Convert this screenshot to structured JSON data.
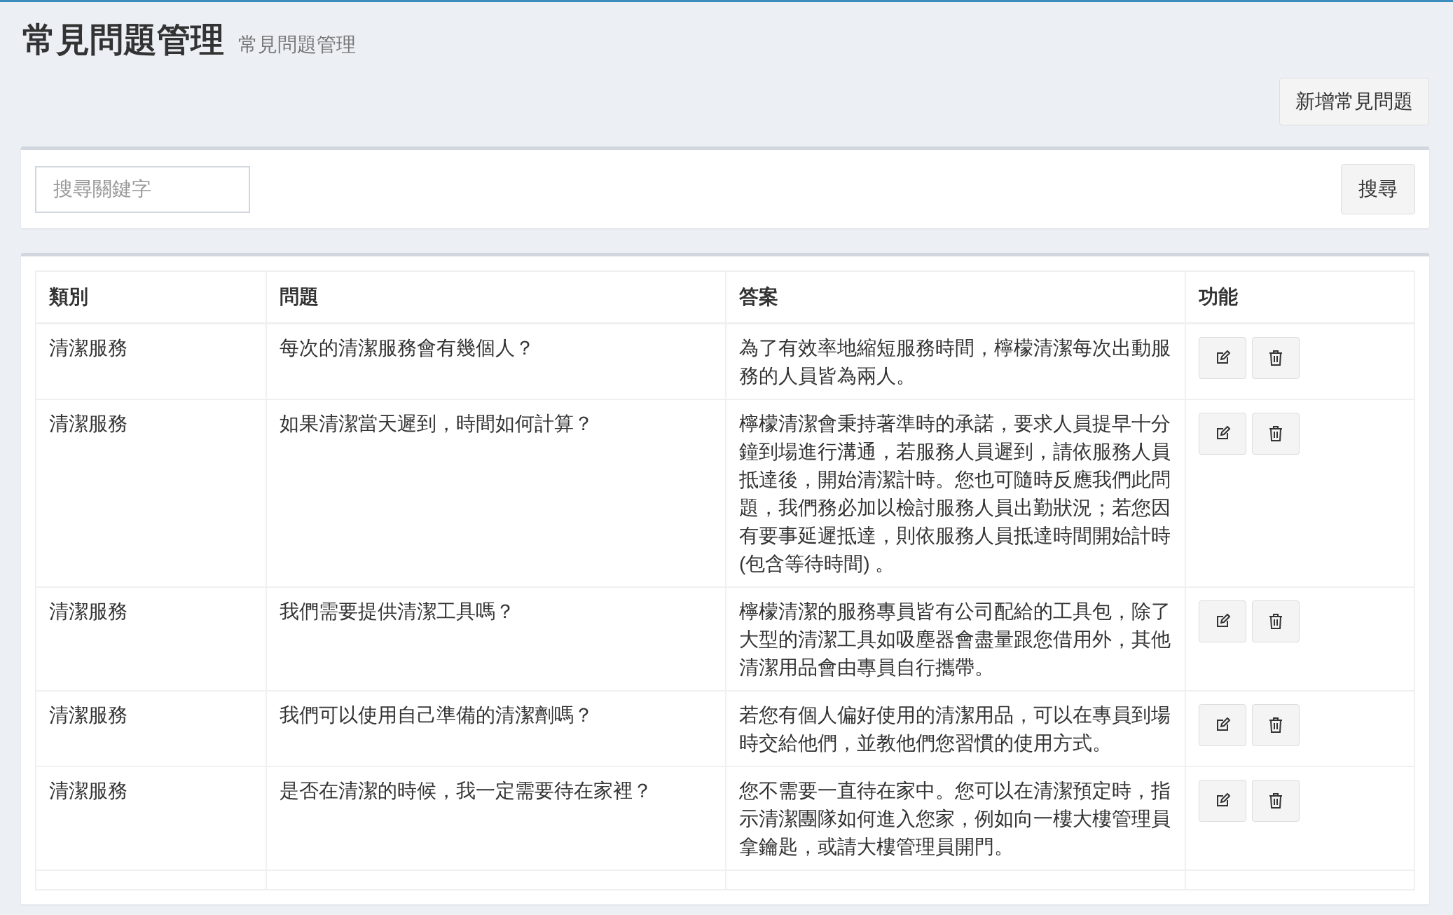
{
  "header": {
    "title": "常見問題管理",
    "subtitle": "常見問題管理"
  },
  "add_button": "新增常見問題",
  "search": {
    "placeholder": "搜尋關鍵字",
    "button": "搜尋"
  },
  "table": {
    "columns": [
      "類別",
      "問題",
      "答案",
      "功能"
    ],
    "rows": [
      {
        "category": "清潔服務",
        "question": "每次的清潔服務會有幾個人？",
        "answer": "為了有效率地縮短服務時間，檸檬清潔每次出動服務的人員皆為兩人。"
      },
      {
        "category": "清潔服務",
        "question": "如果清潔當天遲到，時間如何計算？",
        "answer": "檸檬清潔會秉持著準時的承諾，要求人員提早十分鐘到場進行溝通，若服務人員遲到，請依服務人員抵達後，開始清潔計時。您也可隨時反應我們此問題，我們務必加以檢討服務人員出勤狀況；若您因有要事延遲抵達，則依服務人員抵達時間開始計時(包含等待時間) 。"
      },
      {
        "category": "清潔服務",
        "question": "我們需要提供清潔工具嗎？",
        "answer": "檸檬清潔的服務專員皆有公司配給的工具包，除了大型的清潔工具如吸塵器會盡量跟您借用外，其他清潔用品會由專員自行攜帶。"
      },
      {
        "category": "清潔服務",
        "question": "我們可以使用自己準備的清潔劑嗎？",
        "answer": "若您有個人偏好使用的清潔用品，可以在專員到場時交給他們，並教他們您習慣的使用方式。"
      },
      {
        "category": "清潔服務",
        "question": "是否在清潔的時候，我一定需要待在家裡？",
        "answer": "您不需要一直待在家中。您可以在清潔預定時，指示清潔團隊如何進入您家，例如向一樓大樓管理員拿鑰匙，或請大樓管理員開門。"
      }
    ]
  }
}
